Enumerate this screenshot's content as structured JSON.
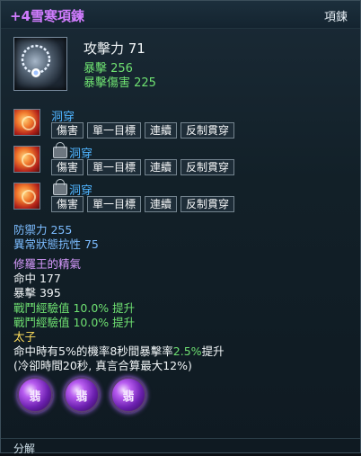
{
  "tooltip": {
    "title": "+4雪寒項鍊",
    "type": "項鍊",
    "attack_label": "攻擊力 71",
    "base_stats": [
      "暴擊 256",
      "暴擊傷害 225"
    ],
    "sockets": [
      {
        "name": "洞穿",
        "locked": false,
        "tags": [
          "傷害",
          "單一目標",
          "連續",
          "反制貫穿"
        ]
      },
      {
        "name": "洞穿",
        "locked": true,
        "tags": [
          "傷害",
          "單一目標",
          "連續",
          "反制貫穿"
        ]
      },
      {
        "name": "洞穿",
        "locked": true,
        "tags": [
          "傷害",
          "單一目標",
          "連續",
          "反制貫穿"
        ]
      }
    ],
    "bonus_stats": [
      "防禦力 255",
      "異常狀態抗性 75"
    ],
    "set_title": "修羅王的精氣",
    "set_stats": [
      "命中 177",
      "暴擊 395"
    ],
    "exp_lines": [
      "戰鬥經驗值 10.0% 提升",
      "戰鬥經驗值 10.0% 提升"
    ],
    "class_name": "太子",
    "effect_prefix": "命中時有5%的機率8秒間暴擊率",
    "effect_highlight": "2.5%",
    "effect_suffix": "提升",
    "effect_note": "(冷卻時間20秒, 真言合算最大12%)",
    "gems": [
      "翡",
      "翡",
      "翡"
    ],
    "split_label": "分解"
  },
  "colors": {
    "title": "#d17cff",
    "green": "#6ee071",
    "socket_name": "#4fb4ff",
    "highlight": "#ffdf5c"
  }
}
